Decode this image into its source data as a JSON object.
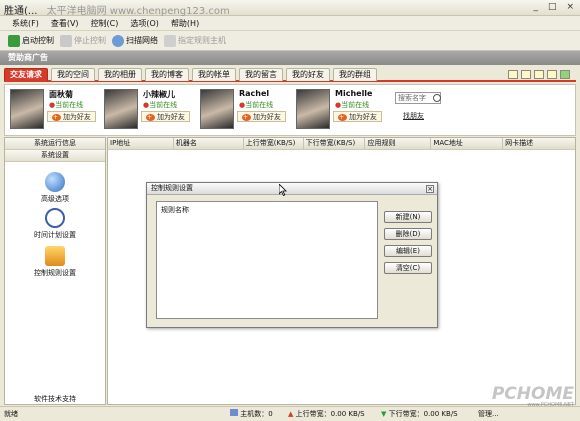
{
  "window": {
    "title": "胜通(...",
    "watermark_text": "太平洋电脑网 www.chenpeng123.com",
    "buttons": [
      "_",
      "□",
      "×"
    ]
  },
  "menu": [
    "系统(F)",
    "查看(V)",
    "控制(C)",
    "选项(O)",
    "帮助(H)"
  ],
  "toolbar": [
    {
      "label": "启动控制",
      "enabled": true
    },
    {
      "label": "停止控制",
      "enabled": false
    },
    {
      "label": "扫描网络",
      "enabled": true
    },
    {
      "label": "指定规则主机",
      "enabled": false
    }
  ],
  "ad_bar": "赞助商广告",
  "tabs": [
    "交友请求",
    "我的空间",
    "我的相册",
    "我的博客",
    "我的帐单",
    "我的留言",
    "我的好友",
    "我的群组"
  ],
  "friends": [
    {
      "name": "面秋菊",
      "status": "当前在线",
      "add": "加为好友"
    },
    {
      "name": "小辣椒儿",
      "status": "当前在线",
      "add": "加为好友"
    },
    {
      "name": "Rachel",
      "status": "当前在线",
      "add": "加为好友"
    },
    {
      "name": "Michelle",
      "status": "当前在线",
      "add": "加为好友"
    }
  ],
  "search": {
    "placeholder": "搜索名字",
    "find": "找朋友"
  },
  "left": {
    "header1": "系统运行信息",
    "header2": "系统设置",
    "item1": "高级选项",
    "item2": "时间计划设置",
    "item3": "控制规则设置",
    "footer": "软件技术支持"
  },
  "grid_columns": [
    "IP地址",
    "机器名",
    "上行带宽(KB/S)",
    "下行带宽(KB/S)",
    "应用规则",
    "MAC地址",
    "网卡描述"
  ],
  "status": {
    "ready": "就绪",
    "hosts": "主机数：0",
    "up": "上行带宽：0.00 KB/S",
    "down": "下行带宽：0.00 KB/S",
    "mgr": "管理..."
  },
  "dialog": {
    "title": "控制规则设置",
    "list_header": "规则名称",
    "new": "新建(N)",
    "delete": "删除(D)",
    "edit": "编辑(E)",
    "clear": "清空(C)",
    "close": "×"
  },
  "brand": {
    "watermark": "PCHOME",
    "url": "www.PCHOME.NET"
  },
  "colors": {
    "accent": "#d63a2a",
    "online": "#2f8f1f"
  }
}
